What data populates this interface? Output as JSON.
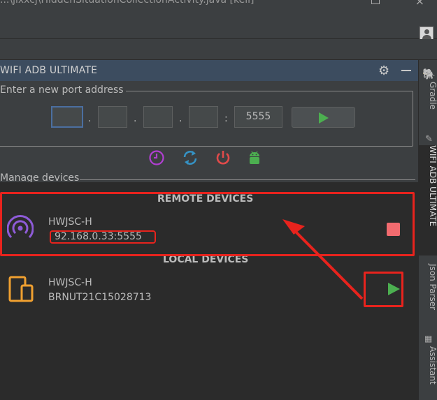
{
  "window": {
    "title": "...\\jixxcj\\HiddenSituationCollectionActivity.java [kell]"
  },
  "panel": {
    "title": "WIFI ADB ULTIMATE",
    "port_legend": "Enter a new port address",
    "ip_fields": [
      "",
      "",
      "",
      ""
    ],
    "port_value": "5555",
    "separators": [
      ".",
      ".",
      ".",
      ":"
    ],
    "manage_legend": "Manage devices"
  },
  "actions": [
    {
      "name": "history",
      "color": "#b13fd2"
    },
    {
      "name": "refresh",
      "color": "#3592c4"
    },
    {
      "name": "power",
      "color": "#e04a4a"
    },
    {
      "name": "android",
      "color": "#4caf50"
    }
  ],
  "remote": {
    "section_title": "REMOTE DEVICES",
    "device_name": "HWJSC-H",
    "device_address": "92.168.0.33:5555",
    "icon_color": "#8e5bd8"
  },
  "local": {
    "section_title": "LOCAL DEVICES",
    "device_name": "HWJSC-H",
    "device_serial": "BRNUT21C15028713",
    "icon_color": "#f0a030"
  },
  "sidebar_tabs": {
    "gradle": "Gradle",
    "wifi_adb": "WIFI ADB ULTIMATE",
    "json_parser": "Json Parser",
    "assistant": "Assistant"
  },
  "colors": {
    "annotation_red": "#e8231d",
    "play_green": "#4caf50",
    "stop_red": "#f26b6f"
  }
}
